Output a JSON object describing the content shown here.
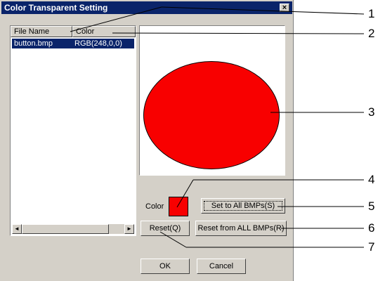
{
  "window": {
    "title": "Color Transparent Setting",
    "close_glyph": "×"
  },
  "file_list": {
    "columns": [
      "File Name",
      "Color"
    ],
    "rows": [
      {
        "file_name": "button.bmp",
        "color": "RGB(248,0,0)"
      }
    ],
    "scroll_left": "◄",
    "scroll_right": "►"
  },
  "preview": {
    "shape": "circle",
    "fill_color": "#f80000"
  },
  "color_setting": {
    "label": "Color",
    "swatch_color": "#f80000"
  },
  "buttons": {
    "set_to_all": "Set to All BMPs(S)",
    "reset_from_all": "Reset from ALL BMPs(R)",
    "reset": "Reset(Q)",
    "ok": "OK",
    "cancel": "Cancel"
  },
  "callouts": [
    "1",
    "2",
    "3",
    "4",
    "5",
    "6",
    "7"
  ]
}
